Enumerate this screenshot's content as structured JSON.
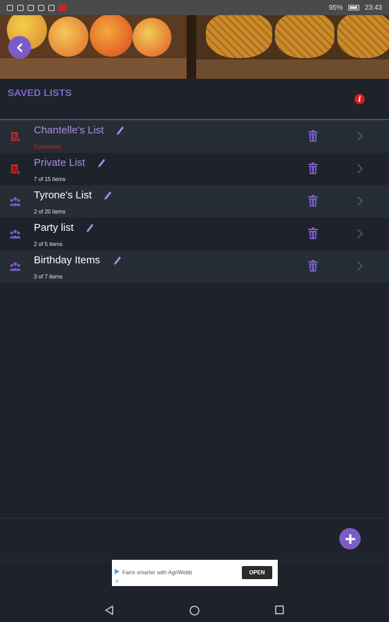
{
  "status_bar": {
    "battery": "95%",
    "time": "23:43"
  },
  "header": {
    "title": "SAVED LISTS"
  },
  "colors": {
    "accent": "#8168c9",
    "alert_red": "#d81c1c",
    "row_alt": "#262d35",
    "background": "#1e222b"
  },
  "lists": [
    {
      "name": "Chantelle's List",
      "status": "Completed",
      "completed": true,
      "type_icon": "list-red-icon"
    },
    {
      "name": "Private List",
      "status": "7 of 15 items",
      "completed": false,
      "type_icon": "list-red-icon"
    },
    {
      "name": "Tyrone's List",
      "status": "2 of 20 items",
      "completed": false,
      "type_icon": "group-icon"
    },
    {
      "name": "Party list",
      "status": "2 of 5 items",
      "completed": false,
      "type_icon": "group-icon"
    },
    {
      "name": "Birthday Items",
      "status": "3 of 7 items",
      "completed": false,
      "type_icon": "group-icon"
    }
  ],
  "ad": {
    "text": "Farm smarter with AgriWebb",
    "button": "OPEN"
  },
  "info_glyph": "i"
}
